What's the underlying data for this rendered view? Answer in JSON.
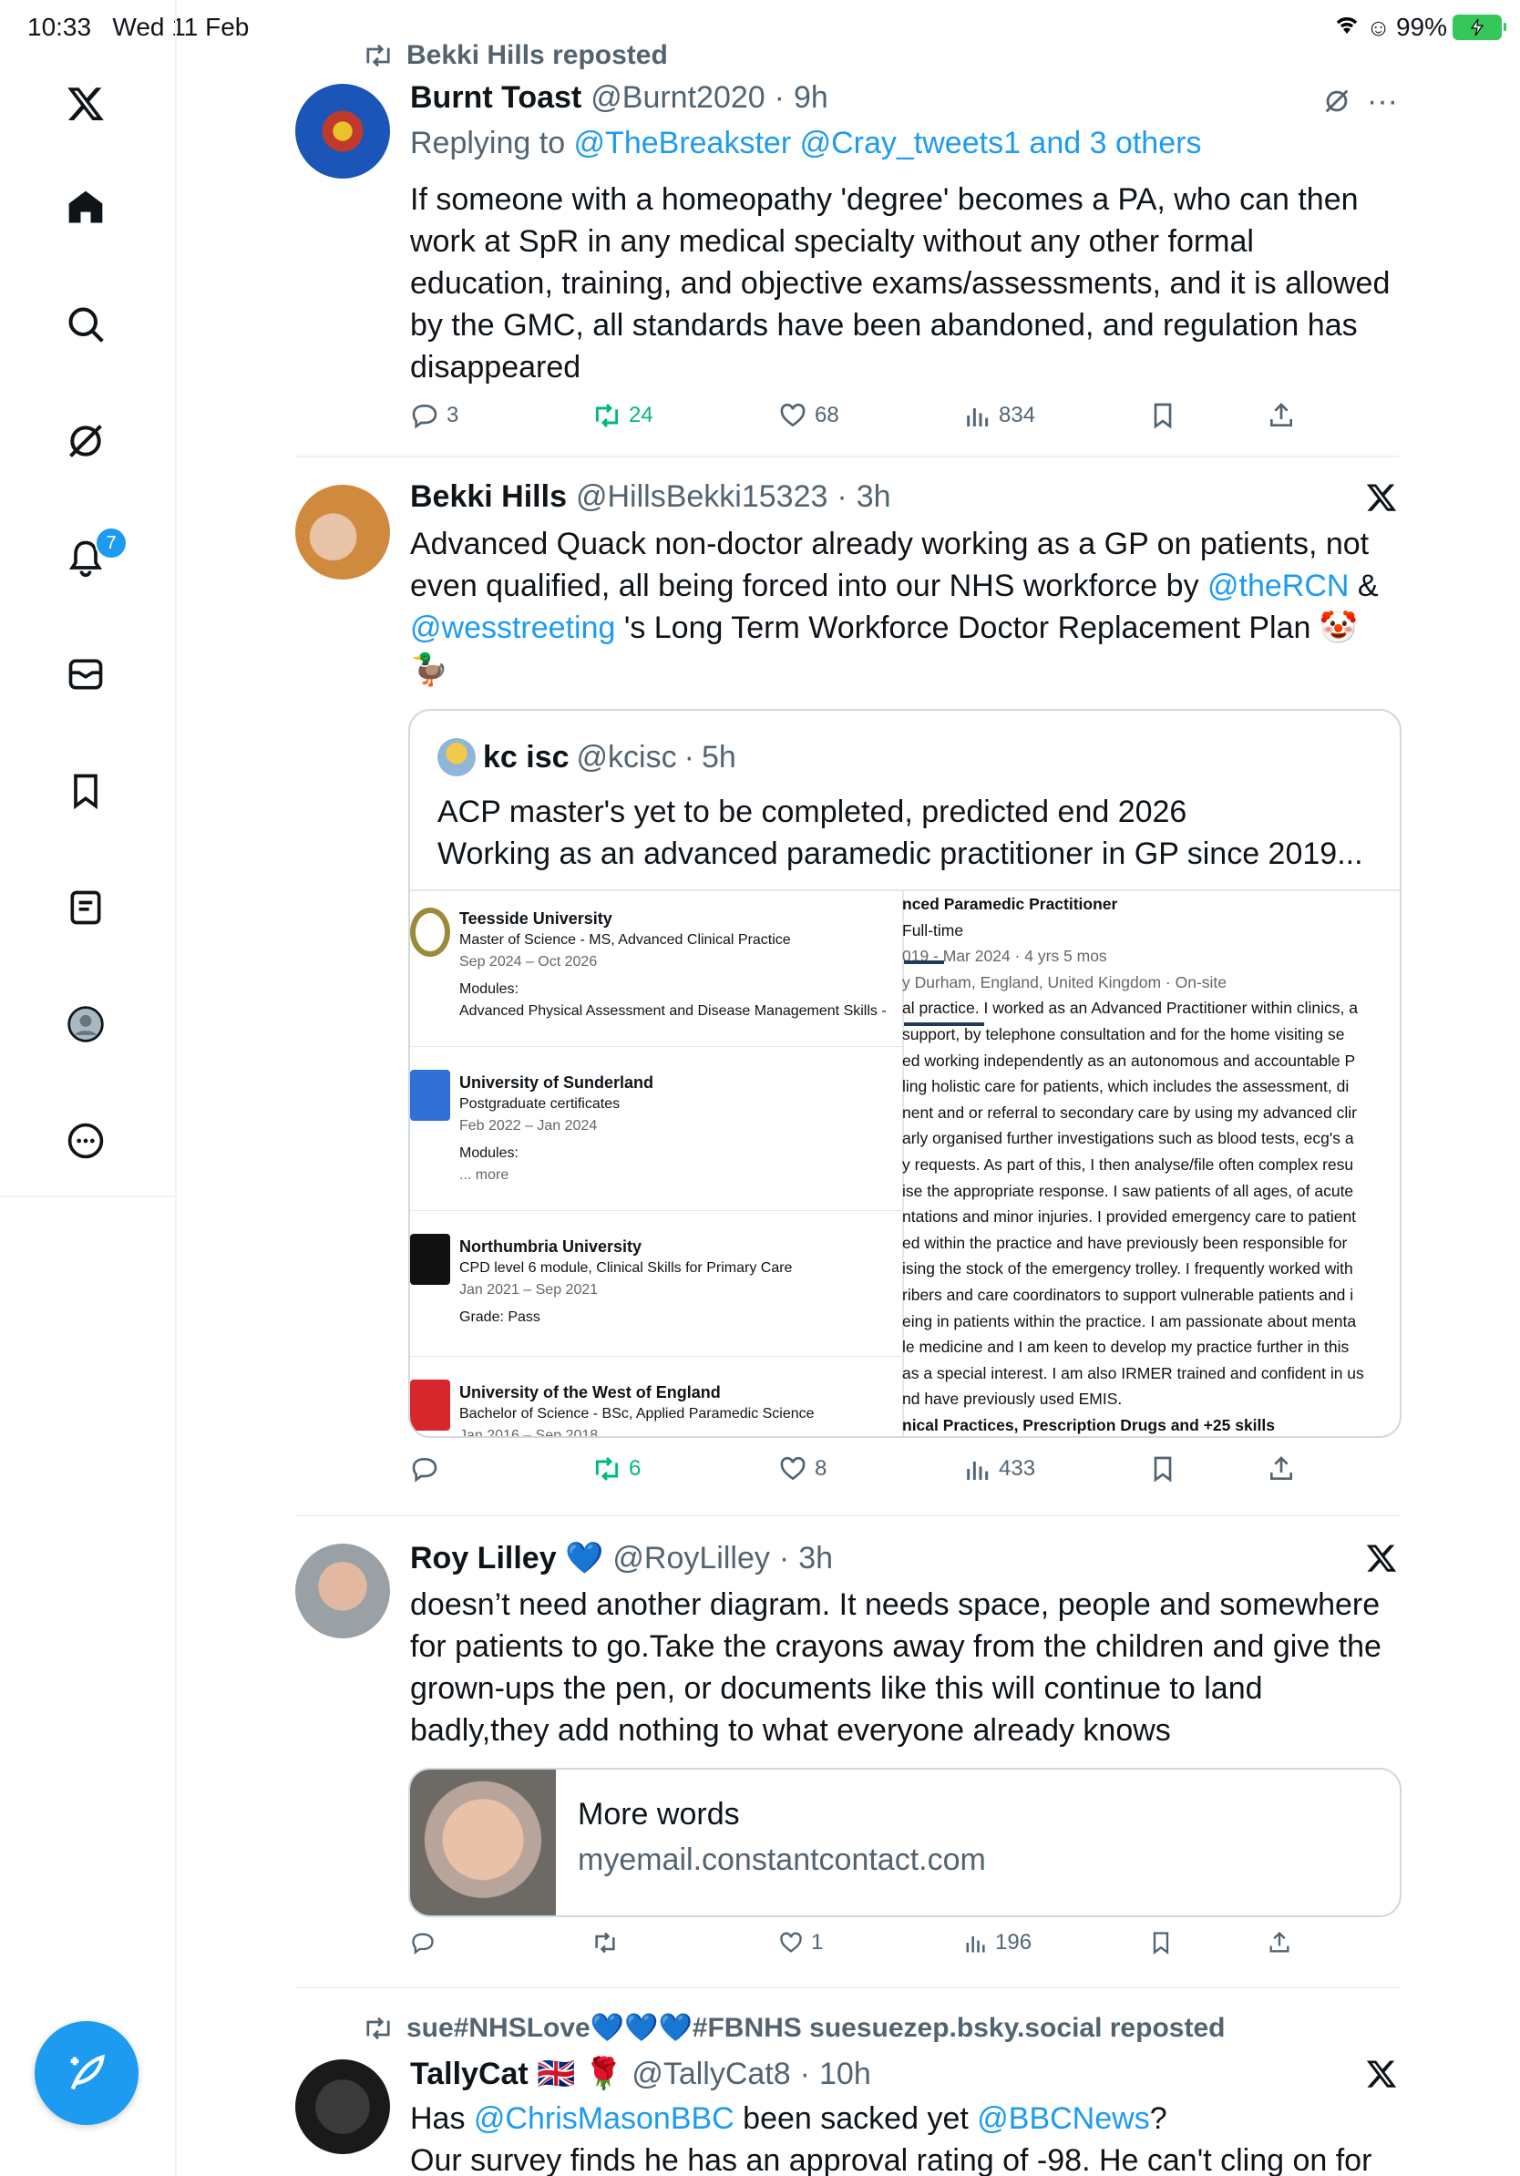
{
  "status": {
    "time": "10:33",
    "date": "Wed 11 Feb",
    "battery": "99%"
  },
  "nav": {
    "items": [
      "x-logo",
      "home",
      "search",
      "grok",
      "notifications",
      "messages",
      "bookmarks",
      "lists",
      "profile",
      "more"
    ],
    "notification_count": "7"
  },
  "tweet1": {
    "repost_by": "Bekki Hills reposted",
    "name": "Burnt Toast",
    "handle": "@Burnt2020",
    "time": "9h",
    "replying_prefix": "Replying to ",
    "replying_to": "@TheBreakster @Cray_tweets1 and 3 others",
    "text": "If someone with a homeopathy 'degree' becomes a PA, who can then work at SpR in any medical specialty without any other formal education, training, and objective exams/assessments, and it is allowed by the GMC, all standards have been abandoned, and regulation has disappeared",
    "replies": "3",
    "reposts": "24",
    "likes": "68",
    "views": "834"
  },
  "tweet2": {
    "name": "Bekki Hills",
    "handle": "@HillsBekki15323",
    "time": "3h",
    "text_a": "Advanced Quack non-doctor already working as a GP on patients, not even qualified, all being forced into our NHS workforce by ",
    "mention1": "@theRCN",
    "text_b": " & ",
    "mention2": "@wesstreeting",
    "text_c": " 's Long Term Workforce Doctor Replacement Plan 🤡 🦆",
    "quote": {
      "name": "kc isc",
      "handle": "@kcisc",
      "time": "5h",
      "line1": "ACP master's yet to be completed, predicted end 2026",
      "line2": "Working as an advanced paramedic practitioner in GP since 2019..."
    },
    "education": [
      {
        "school": "Teesside University",
        "degree": "Master of Science - MS, Advanced Clinical Practice",
        "dates": "Sep 2024 – Oct 2026",
        "extra1": "Modules:",
        "extra2": "Advanced Physical Assessment and Disease Management Skills -"
      },
      {
        "school": "University of Sunderland",
        "degree": "Postgraduate certificates",
        "dates": "Feb 2022 – Jan 2024",
        "extra1": "Modules:",
        "extra2": "... more"
      },
      {
        "school": "Northumbria University",
        "degree": "CPD level 6 module, Clinical Skills for Primary Care",
        "dates": "Jan 2021 – Sep 2021",
        "extra1": "Grade: Pass",
        "extra2": ""
      },
      {
        "school": "University of the West of England",
        "degree": "Bachelor of Science - BSc, Applied Paramedic Science",
        "dates": "Jan 2016 – Sep 2018",
        "extra1": "",
        "extra2": ""
      }
    ],
    "experience": [
      "nced Paramedic Practitioner",
      "Full-time",
      "019 - Mar 2024 · 4 yrs 5 mos",
      "y Durham, England, United Kingdom · On-site",
      "al practice. I worked as an Advanced Practitioner within clinics, a",
      "support, by telephone consultation and for the home visiting se",
      "ed working independently as an autonomous and accountable P",
      "ling holistic care for patients, which includes the assessment, di",
      "nent and or referral to secondary care by using my advanced clir",
      "arly organised further investigations such as blood tests, ecg's a",
      "y requests. As part of this, I then analyse/file often complex resu",
      "ise the appropriate response. I saw patients of all ages, of acute",
      "ntations and minor injuries. I provided emergency care to patient",
      "ed within the practice and have previously been responsible for",
      "ising the stock of the emergency trolley. I frequently worked with",
      "ribers and care coordinators to support vulnerable patients and i",
      "eing in patients within the practice. I am passionate about menta",
      "le medicine and I am keen to develop my practice further in this",
      "as a special interest. I am also IRMER trained and confident in us",
      "nd have previously used EMIS.",
      "nical Practices, Prescription Drugs and +25 skills"
    ],
    "replies": "",
    "reposts": "6",
    "likes": "8",
    "views": "433"
  },
  "tweet3": {
    "name": "Roy Lilley 💙",
    "handle": "@RoyLilley",
    "time": "3h",
    "text": "doesn’t need another diagram. It needs space, people and somewhere for patients to go.Take the crayons away from the children and give the grown-ups the pen, or documents like this will continue to land badly,they add nothing to what everyone already knows",
    "card_title": "More words",
    "card_domain": "myemail.constantcontact.com",
    "replies": "",
    "reposts": "",
    "likes": "1",
    "views": "196"
  },
  "tweet4": {
    "repost_by": "sue#NHSLove💙💙💙#FBNHS suesuezep.bsky.social reposted",
    "name": "TallyCat 🇬🇧 🌹",
    "handle": "@TallyCat8",
    "time": "10h",
    "text_a": "Has ",
    "mention1": "@ChrisMasonBBC",
    "text_b": " been sacked yet ",
    "mention2": "@BBCNews",
    "text_c": "?",
    "line2": "Our survey finds he has an approval rating of -98. He can't cling on for"
  },
  "colors": {
    "accent": "#1d9bf0",
    "repost_green": "#00ba7c",
    "muted": "#536471"
  }
}
